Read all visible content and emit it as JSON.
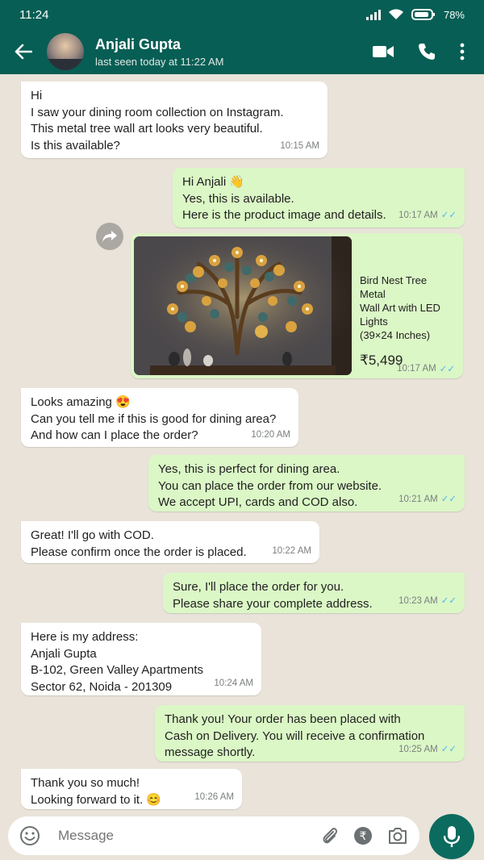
{
  "status_bar": {
    "time": "11:24",
    "battery": "78%"
  },
  "header": {
    "back_icon": "arrow-left-icon",
    "contact_name": "Anjali Gupta",
    "last_seen": "last seen today at 11:22 AM",
    "icons": [
      "video-call-icon",
      "phone-icon",
      "more-vert-icon"
    ]
  },
  "messages": [
    {
      "dir": "in",
      "lines": [
        "Hi",
        "I saw your dining room collection on Instagram.",
        "This metal tree wall art looks very beautiful.",
        "Is this available?"
      ],
      "time": "10:15 AM"
    },
    {
      "dir": "out",
      "lines": [
        "Hi Anjali 👋",
        "Yes, this is available.",
        "Here is the product image and details."
      ],
      "time": "10:17 AM"
    },
    {
      "dir": "in",
      "lines": [
        "Looks amazing 😍",
        "Can you tell me if this is good for dining area?",
        "And how can I place the order?"
      ],
      "time": "10:20 AM"
    },
    {
      "dir": "out",
      "lines": [
        "Yes, this is perfect for dining area.",
        "You can place the order from our website.",
        "We accept UPI, cards and COD also."
      ],
      "time": "10:21 AM"
    },
    {
      "dir": "in",
      "lines": [
        "Great! I'll go with COD.",
        "Please confirm once the order is placed."
      ],
      "time": "10:22 AM"
    },
    {
      "dir": "out",
      "lines": [
        "Sure, I'll place the order for you.",
        "Please share your complete address."
      ],
      "time": "10:23 AM"
    },
    {
      "dir": "in",
      "lines": [
        "Here is my address:",
        "Anjali Gupta",
        "B-102, Green Valley Apartments",
        "Sector 62, Noida - 201309"
      ],
      "time": "10:24 AM"
    },
    {
      "dir": "out",
      "lines": [
        "Thank you! Your order has been placed with",
        "Cash on Delivery. You will receive a confirmation",
        "message shortly."
      ],
      "time": "10:25 AM"
    },
    {
      "dir": "in",
      "lines": [
        "Thank you so much!",
        "Looking forward to it. 😊"
      ],
      "time": "10:26 AM"
    }
  ],
  "product_card": {
    "title_lines": [
      "Bird Nest Tree Metal",
      "Wall Art with LED Lights",
      "(39×24 Inches)"
    ],
    "price": "₹5,499",
    "time": "10:17 AM"
  },
  "input": {
    "placeholder": "Message",
    "icons": [
      "emoji-icon",
      "attach-icon",
      "rupee-payment-icon",
      "camera-icon",
      "mic-icon"
    ]
  },
  "colors": {
    "header": "#075e54",
    "outgoing_bubble": "#dbf7c6",
    "incoming_bubble": "#ffffff",
    "read_ticks": "#4fb6ec",
    "mic_button": "#0c6b5f"
  }
}
